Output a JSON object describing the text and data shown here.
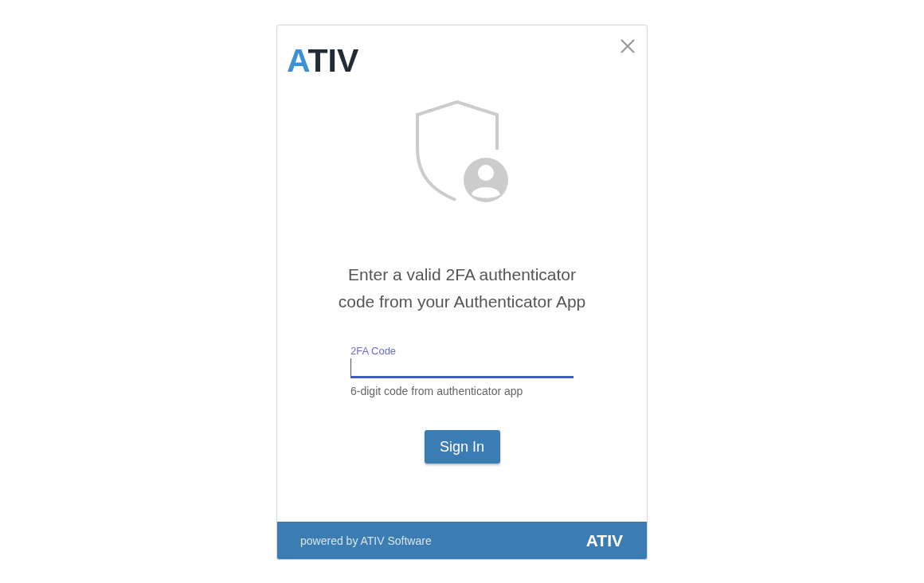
{
  "dialog": {
    "logo": "ATIV",
    "prompt_lines": [
      "Enter a valid 2FA authenticator",
      "code from your Authenticator App"
    ],
    "code_field": {
      "label": "2FA Code",
      "focused": true,
      "helper": "6-digit code from authenticator app"
    },
    "sign_in_button": "Sign In",
    "footer": {
      "text": "powered by ATIV Software",
      "logo": "ATIV"
    }
  }
}
